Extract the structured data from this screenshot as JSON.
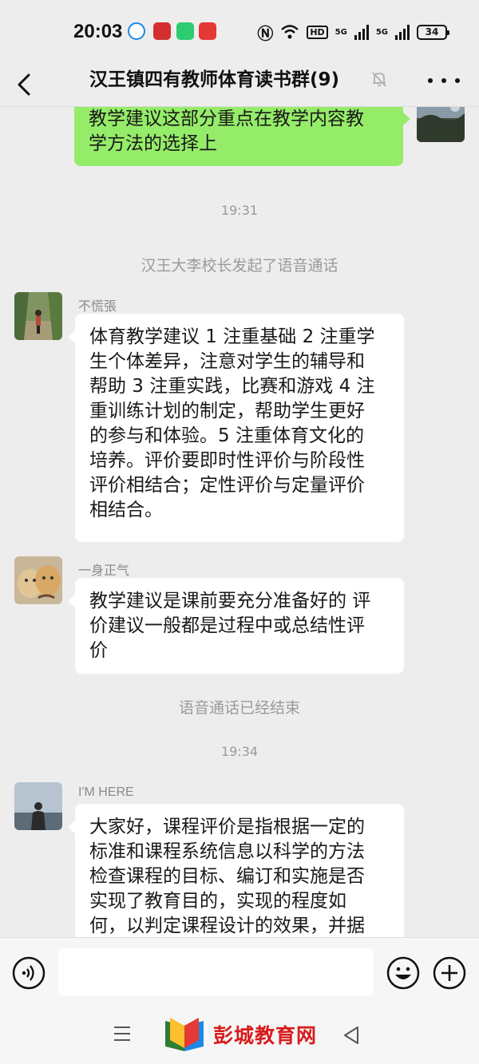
{
  "status_bar": {
    "time": "20:03",
    "battery": "34",
    "signal_labels": [
      "5G",
      "5G"
    ],
    "icons": [
      "location-app-icon",
      "news-app-icon",
      "message-app-icon",
      "shop-app-icon",
      "nfc-icon",
      "wifi-icon",
      "hd-icon",
      "signal-icon",
      "signal-icon",
      "battery-icon"
    ]
  },
  "nav": {
    "title": "汉王镇四有教师体育读书群(9)",
    "icons": [
      "back-icon",
      "mute-icon",
      "more-icon"
    ]
  },
  "messages": {
    "m1": {
      "text": "教学建议这部分重点在教学内容教\n学方法的选择上"
    },
    "t1": "19:31",
    "s1": "汉王大李校长发起了语音通话",
    "m2": {
      "sender": "不慌張",
      "text": "体育教学建议 1 注重基础 2 注重学\n生个体差异，注意对学生的辅导和\n帮助 3 注重实践，比赛和游戏 4 注\n重训练计划的制定，帮助学生更好\n的参与和体验。5 注重体育文化的\n培养。评价要即时性评价与阶段性\n评价相结合；定性评价与定量评价\n相结合。"
    },
    "m3": {
      "sender": "一身正气",
      "text": "教学建议是课前要充分准备好的 评\n价建议一般都是过程中或总结性评\n价"
    },
    "s2": "语音通话已经结束",
    "t2": "19:34",
    "m4": {
      "sender": "I'M HERE",
      "text": "大家好，课程评价是指根据一定的\n标准和课程系统信息以科学的方法\n检查课程的目标、编订和实施是否\n实现了教育目的，实现的程度如\n何，以判定课程设计的效果，并据"
    }
  },
  "input_bar": {
    "placeholder": "",
    "icons": [
      "voice-icon",
      "emoji-icon",
      "plus-icon"
    ]
  },
  "watermark": {
    "text": "彭城教育网"
  },
  "colors": {
    "self_bubble": "#95ec69",
    "other_bubble": "#ffffff",
    "background": "#ededed"
  }
}
